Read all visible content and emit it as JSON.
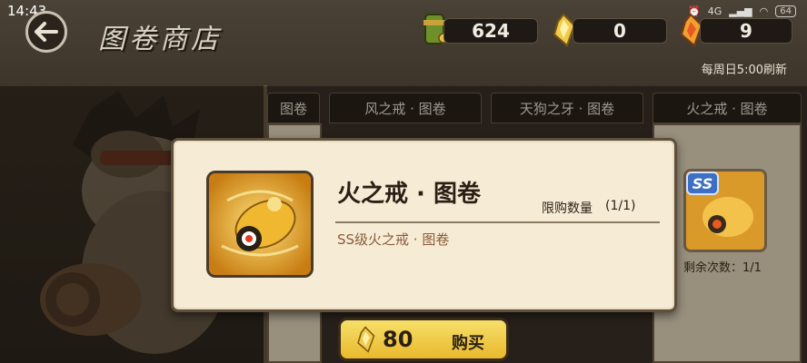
{
  "status_bar": {
    "time": "14:43",
    "network": "4G",
    "battery": "64"
  },
  "header": {
    "title": "图卷商店"
  },
  "currencies": [
    {
      "icon": "scroll-currency-icon",
      "value": "624"
    },
    {
      "icon": "gold-shard-icon",
      "value": "0"
    },
    {
      "icon": "flame-shard-icon",
      "value": "9"
    }
  ],
  "refresh_note": "每周日5:00刷新",
  "tabs": [
    {
      "label": "图卷"
    },
    {
      "label": "风之戒 · 图卷"
    },
    {
      "label": "天狗之牙 · 图卷"
    },
    {
      "label": "火之戒 · 图卷"
    }
  ],
  "modal": {
    "item_name": "火之戒 · 图卷",
    "limit_label": "限购数量",
    "limit_value": "(1/1)",
    "description": "SS级火之戒 · 图卷"
  },
  "buy_button": {
    "price": "80",
    "label": "购买"
  },
  "side_card": {
    "grade_badge": "SS",
    "remaining": "剩余次数：1/1"
  },
  "colors": {
    "accent_gold": "#e9b92d",
    "modal_bg": "#f6ecd6",
    "desc_text": "#8a5a3a",
    "ss_badge": "#3d6fc4"
  }
}
